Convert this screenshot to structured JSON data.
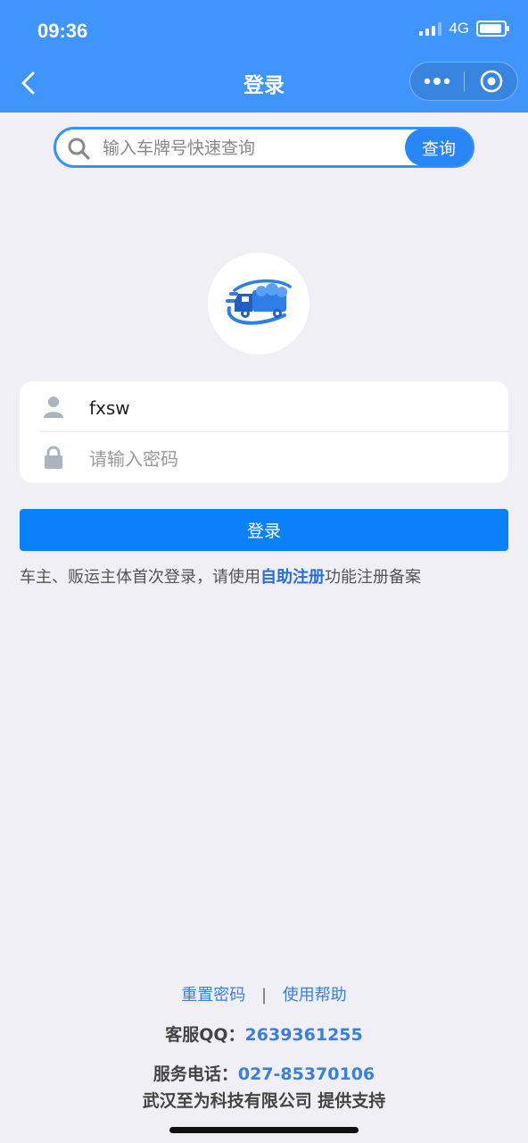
{
  "status": {
    "time": "09:36",
    "network": "4G"
  },
  "nav": {
    "title": "登录"
  },
  "search": {
    "placeholder": "输入车牌号快速查询",
    "button_label": "查询"
  },
  "login": {
    "username_value": "fxsw",
    "password_placeholder": "请输入密码",
    "submit_label": "登录"
  },
  "notice": {
    "prefix": "车主、贩运主体首次登录，请使用",
    "link": "自助注册",
    "suffix": "功能注册备案"
  },
  "footer": {
    "reset_password": "重置密码",
    "separator": "|",
    "help": "使用帮助",
    "qq_label": "客服QQ：",
    "qq_value": "2639361255",
    "phone_label": "服务电话：",
    "phone_value": "027-85370106",
    "company": "武汉至为科技有限公司 提供支持"
  },
  "icons": {
    "back": "chevron-left-icon",
    "more": "more-dots-icon",
    "close": "capsule-close-icon",
    "search": "search-icon",
    "user": "user-icon",
    "lock": "lock-icon",
    "logo": "truck-logo-icon"
  },
  "colors": {
    "nav_bg": "#3f95fb",
    "primary": "#0a80fb",
    "link": "#3c7fd8",
    "page_bg": "#f0eff5"
  }
}
